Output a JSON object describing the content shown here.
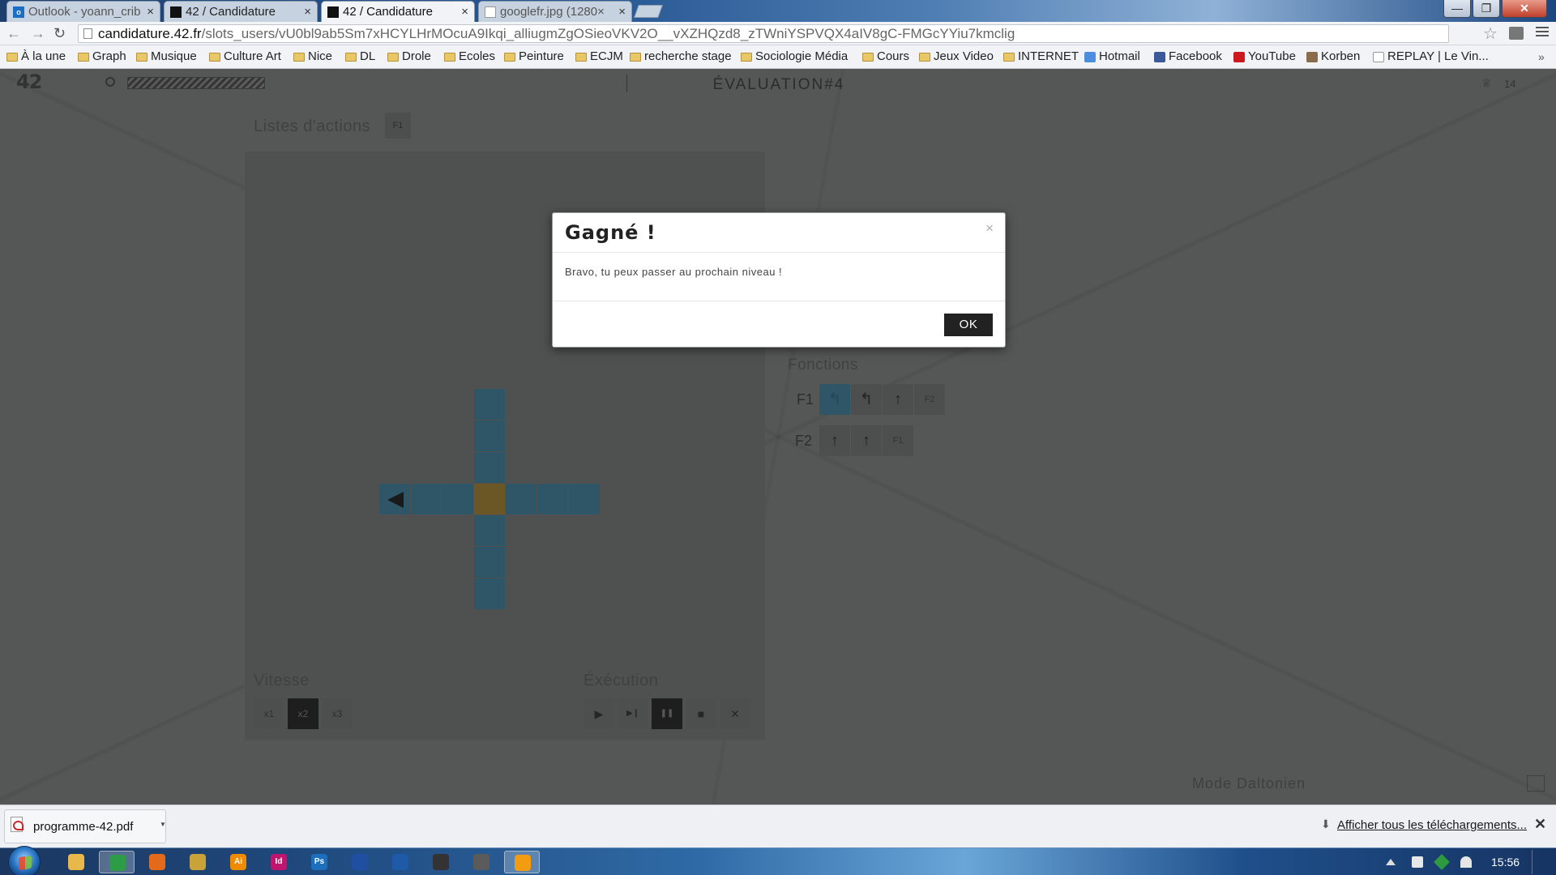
{
  "browser": {
    "tabs": [
      {
        "title": "Outlook - yoann_crib",
        "state": "inactive"
      },
      {
        "title": "42 / Candidature",
        "state": "inactive"
      },
      {
        "title": "42 / Candidature",
        "state": "active"
      },
      {
        "title": "googlefr.jpg (1280×",
        "state": "inactive"
      }
    ],
    "tab_close": "×",
    "window_controls": {
      "minimize": "—",
      "maximize": "❐",
      "close": "✕"
    },
    "address": {
      "host": "candidature.42.fr",
      "path": "/slots_users/vU0bl9ab5Sm7xHCYLHrMOcuA9Ikqi_alliugmZgOSieoVKV2O__vXZHQzd8_zTWniYSPVQX4aIV8gC-FMGcYYiu7kmclig"
    },
    "nav": {
      "back": "←",
      "forward": "→",
      "reload": "↻",
      "star": "☆"
    },
    "bookmarks": [
      {
        "label": "À la une",
        "type": "folder"
      },
      {
        "label": "Graph",
        "type": "folder"
      },
      {
        "label": "Musique",
        "type": "folder"
      },
      {
        "label": "Culture Art",
        "type": "folder"
      },
      {
        "label": "Nice",
        "type": "folder"
      },
      {
        "label": "DL",
        "type": "folder"
      },
      {
        "label": "Drole",
        "type": "folder"
      },
      {
        "label": "Ecoles",
        "type": "folder"
      },
      {
        "label": "Peinture",
        "type": "folder"
      },
      {
        "label": "ECJM",
        "type": "folder"
      },
      {
        "label": "recherche stage",
        "type": "folder"
      },
      {
        "label": "Sociologie Média",
        "type": "folder"
      },
      {
        "label": "Cours",
        "type": "folder"
      },
      {
        "label": "Jeux Video",
        "type": "folder"
      },
      {
        "label": "INTERNET",
        "type": "folder"
      },
      {
        "label": "Hotmail",
        "type": "site",
        "color": "#4b8ee0"
      },
      {
        "label": "Facebook",
        "type": "site",
        "color": "#3b5998"
      },
      {
        "label": "YouTube",
        "type": "site",
        "color": "#cc181e"
      },
      {
        "label": "Korben",
        "type": "site",
        "color": "#8a6b4a"
      },
      {
        "label": "REPLAY | Le Vin...",
        "type": "page"
      }
    ],
    "bookmarks_more": "»"
  },
  "app": {
    "logo": "42",
    "title": "ÉVALUATION#4",
    "trophy_icon": "♕",
    "trophy_count": "14",
    "actions_label": "Listes d'actions",
    "actions_fkey": "F1",
    "speed": {
      "label": "Vitesse",
      "options": [
        "x1",
        "x2",
        "x3"
      ],
      "selected": "x2"
    },
    "execution": {
      "label": "Éxécution",
      "buttons": [
        {
          "name": "play",
          "glyph": "▶",
          "active": false
        },
        {
          "name": "step",
          "glyph": "▶❙",
          "active": false
        },
        {
          "name": "pause",
          "glyph": "❚❚",
          "active": true
        },
        {
          "name": "stop",
          "glyph": "■",
          "active": false
        },
        {
          "name": "reset",
          "glyph": "✕",
          "active": false
        }
      ]
    },
    "functions": {
      "label": "Fonctions",
      "rows": [
        {
          "name": "F1",
          "slots": [
            {
              "glyph": "↰",
              "color": "blue"
            },
            {
              "glyph": "↰",
              "color": "none"
            },
            {
              "glyph": "↑",
              "color": "none"
            },
            {
              "glyph": "F2",
              "color": "call"
            }
          ]
        },
        {
          "name": "F2",
          "slots": [
            {
              "glyph": "↑",
              "color": "none"
            },
            {
              "glyph": "↑",
              "color": "none"
            },
            {
              "glyph": "F1",
              "color": "call"
            }
          ]
        }
      ]
    },
    "colorblind_label": "Mode Daltonien",
    "grid": {
      "robot_direction": "left",
      "current_cell_color": "#6b5725",
      "path_color": "#2f5667"
    }
  },
  "modal": {
    "title": "Gagné !",
    "close": "×",
    "message": "Bravo, tu peux passer au prochain niveau !",
    "ok_label": "OK"
  },
  "downloads": {
    "file_name": "programme-42.pdf",
    "show_all": "Afficher tous les téléchargements...",
    "close": "✕"
  },
  "taskbar": {
    "apps": [
      {
        "name": "explorer",
        "color": "#e8b84a",
        "glyph": ""
      },
      {
        "name": "chrome",
        "color": "#2d9c46",
        "glyph": "",
        "active": true
      },
      {
        "name": "firefox",
        "color": "#e46a1b",
        "glyph": ""
      },
      {
        "name": "unknown-app",
        "color": "#c9a23a",
        "glyph": ""
      },
      {
        "name": "illustrator",
        "color": "#f08a00",
        "glyph": "Ai"
      },
      {
        "name": "indesign",
        "color": "#c0156d",
        "glyph": "Id"
      },
      {
        "name": "photoshop",
        "color": "#1d6fbe",
        "glyph": "Ps"
      },
      {
        "name": "media-app",
        "color": "#1f4ea3",
        "glyph": ""
      },
      {
        "name": "dvd-app",
        "color": "#1e5aa8",
        "glyph": ""
      },
      {
        "name": "unity",
        "color": "#333333",
        "glyph": ""
      },
      {
        "name": "utility-app",
        "color": "#5b5b5b",
        "glyph": ""
      },
      {
        "name": "vlc",
        "color": "#f39c12",
        "glyph": "",
        "active": true
      }
    ],
    "clock": "15:56"
  }
}
